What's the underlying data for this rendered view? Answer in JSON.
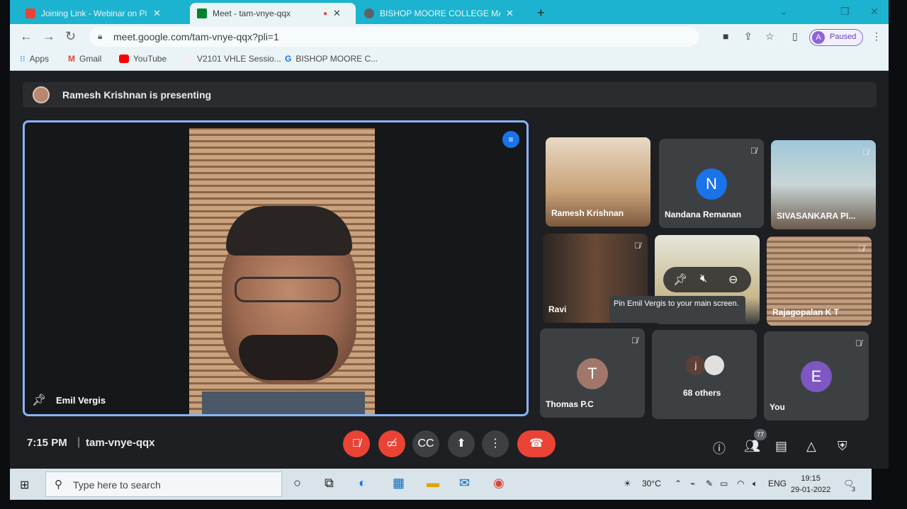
{
  "browser": {
    "tabs": [
      {
        "label": "Joining Link - Webinar on Pitching",
        "favicon": "gmail-icon",
        "active": false
      },
      {
        "label": "Meet - tam-vnye-qqx",
        "favicon": "meet-icon",
        "active": true
      },
      {
        "label": "BISHOP MOORE COLLEGE MAVE",
        "favicon": "globe-icon",
        "active": false
      }
    ],
    "new_tab": "+",
    "url": "meet.google.com/tam-vnye-qqx?pli=1",
    "profile": {
      "initial": "A",
      "status": "Paused"
    },
    "bookmarks": [
      {
        "label": "Apps",
        "icon": "apps-grid-icon"
      },
      {
        "label": "Gmail",
        "icon": "gmail-icon"
      },
      {
        "label": "YouTube",
        "icon": "youtube-icon"
      },
      {
        "label": "V2101 VHLE Sessio...",
        "icon": "page-icon"
      },
      {
        "label": "BISHOP MOORE C...",
        "icon": "refresh-g-icon"
      }
    ]
  },
  "meet": {
    "presenting_banner": "Ramesh Krishnan is presenting",
    "main_speaker": {
      "name": "Emil Vergis"
    },
    "participants": [
      {
        "name": "Ramesh Krishnan",
        "type": "video",
        "muted": false
      },
      {
        "name": "Nandana Remanan",
        "type": "avatar",
        "initial": "N",
        "color": "#1a73e8",
        "muted": true
      },
      {
        "name": "SIVASANKARA PI...",
        "type": "video",
        "muted": true
      },
      {
        "name": "Ravi",
        "type": "video",
        "muted": true
      },
      {
        "name": "Emil Vergis",
        "type": "video",
        "muted": true
      },
      {
        "name": "Rajagopalan K T",
        "type": "video",
        "muted": true
      },
      {
        "name": "Thomas P.C",
        "type": "avatar",
        "initial": "T",
        "color": "#a1776b",
        "muted": true
      },
      {
        "name": "68 others",
        "type": "group",
        "initial": "j"
      },
      {
        "name": "You",
        "type": "avatar",
        "initial": "E",
        "color": "#7e57c2",
        "muted": true
      }
    ],
    "tooltip": "Pin Emil Vergis to your main screen.",
    "time": "7:15 PM",
    "meeting_code": "tam-vnye-qqx",
    "people_count": "77"
  },
  "taskbar": {
    "search_placeholder": "Type here to search",
    "weather": "30°C",
    "language": "ENG",
    "time": "19:15",
    "date": "29-01-2022",
    "notifications": "3"
  }
}
